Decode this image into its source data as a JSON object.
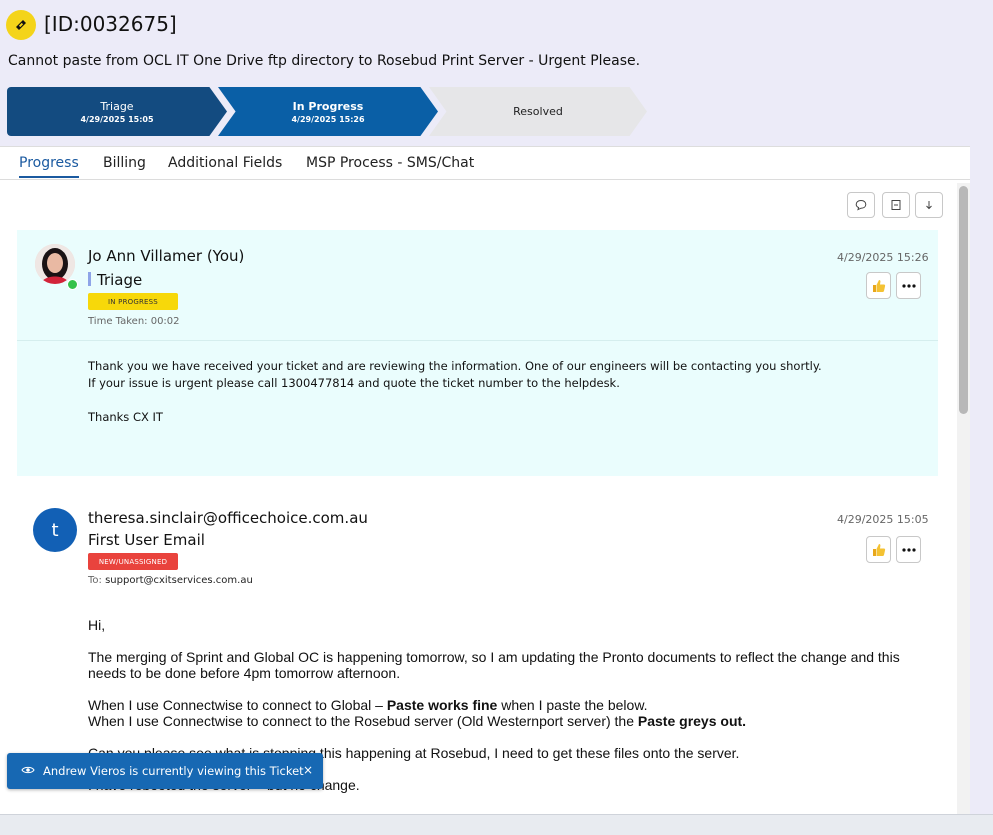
{
  "ticket": {
    "id": "[ID:0032675]",
    "subject": "Cannot paste from OCL IT One Drive ftp directory to Rosebud Print Server - Urgent Please."
  },
  "steps": [
    {
      "name": "Triage",
      "date": "4/29/2025 15:05"
    },
    {
      "name": "In Progress",
      "date": "4/29/2025 15:26"
    },
    {
      "name": "Resolved",
      "date": ""
    }
  ],
  "tabs": [
    "Progress",
    "Billing",
    "Additional Fields",
    "MSP Process - SMS/Chat"
  ],
  "active_tab": "Progress",
  "entries": [
    {
      "author": "Jo Ann Villamer (You)",
      "stage": "Triage",
      "status": "IN PROGRESS",
      "time_taken": "Time Taken: 00:02",
      "date": "4/29/2025 15:26",
      "body": [
        "Thank you we have received your ticket and are reviewing the information. One of our engineers will be contacting you shortly.",
        "If your issue is urgent please call 1300477814 and quote the ticket number to the helpdesk.",
        "",
        "Thanks CX IT"
      ]
    },
    {
      "author": "theresa.sinclair@officechoice.com.au",
      "avatar_letter": "t",
      "stage": "First User Email",
      "status": "NEW/UNASSIGNED",
      "to_label": "To:",
      "to": "support@cxitservices.com.au",
      "date": "4/29/2025 15:05",
      "body": {
        "greeting": "Hi,",
        "p1": "The merging of Sprint and Global OC is happening tomorrow, so I am updating the Pronto documents to reflect the change and this needs to be done before 4pm tomorrow afternoon.",
        "p2a_1": "When I use Connectwise to connect to Global – ",
        "p2a_bold": "Paste works fine",
        "p2a_2": " when I paste the below.",
        "p2b_1": "When I use Connectwise to connect to the Rosebud server (Old Westernport server) the ",
        "p2b_bold": "Paste greys out.",
        "p3": "Can you please see what is stopping this happening at Rosebud, I need to get these files onto the server.",
        "p4": "I have rebooted the server – but no change."
      }
    }
  ],
  "toast": {
    "text": "Andrew Vieros is currently viewing this Ticket",
    "close": "×"
  },
  "colors": {
    "accent": "#1b5aa0",
    "triage": "#134b80",
    "in_progress": "#0a5fa6",
    "badge_progress": "#f7d80a",
    "badge_new": "#e9433d",
    "toast": "#1768b3"
  },
  "icons": {
    "ticket": "ticket-icon",
    "comment": "comment-icon",
    "collapse": "collapse-icon",
    "download": "arrow-down-icon",
    "like": "thumbs-up-icon",
    "more": "more-icon",
    "eye": "eye-icon",
    "close": "close-icon"
  }
}
